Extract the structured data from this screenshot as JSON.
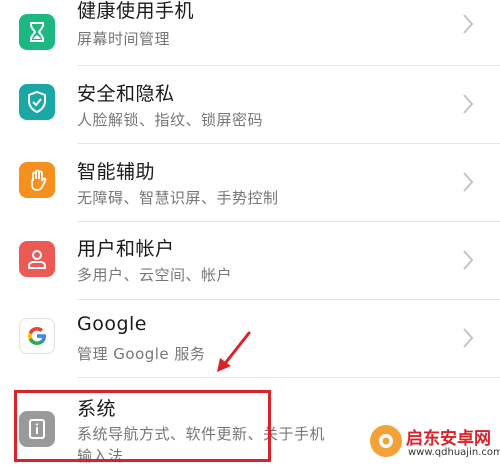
{
  "settings": {
    "items": [
      {
        "title": "健康使用手机",
        "subtitle": "屏幕时间管理",
        "icon": "hourglass-icon",
        "color": "#1db881"
      },
      {
        "title": "安全和隐私",
        "subtitle": "人脸解锁、指纹、锁屏密码",
        "icon": "shield-icon",
        "color": "#1aa7a5"
      },
      {
        "title": "智能辅助",
        "subtitle": "无障碍、智慧识屏、手势控制",
        "icon": "hand-icon",
        "color": "#f5901f"
      },
      {
        "title": "用户和帐户",
        "subtitle": "多用户、云空间、帐户",
        "icon": "person-icon",
        "color": "#ec5a56"
      },
      {
        "title": "Google",
        "subtitle": "管理 Google 服务",
        "icon": "google-icon",
        "color": "#ffffff"
      },
      {
        "title": "系统",
        "subtitle": "系统导航方式、软件更新、关于手机",
        "subtitle2": "输入法",
        "icon": "info-icon",
        "color": "#9a9a9a"
      }
    ]
  },
  "annotation": {
    "highlight_color": "#d8232a"
  },
  "watermark": {
    "title": "启东安卓网",
    "url": "www.qdhuajin.com"
  }
}
